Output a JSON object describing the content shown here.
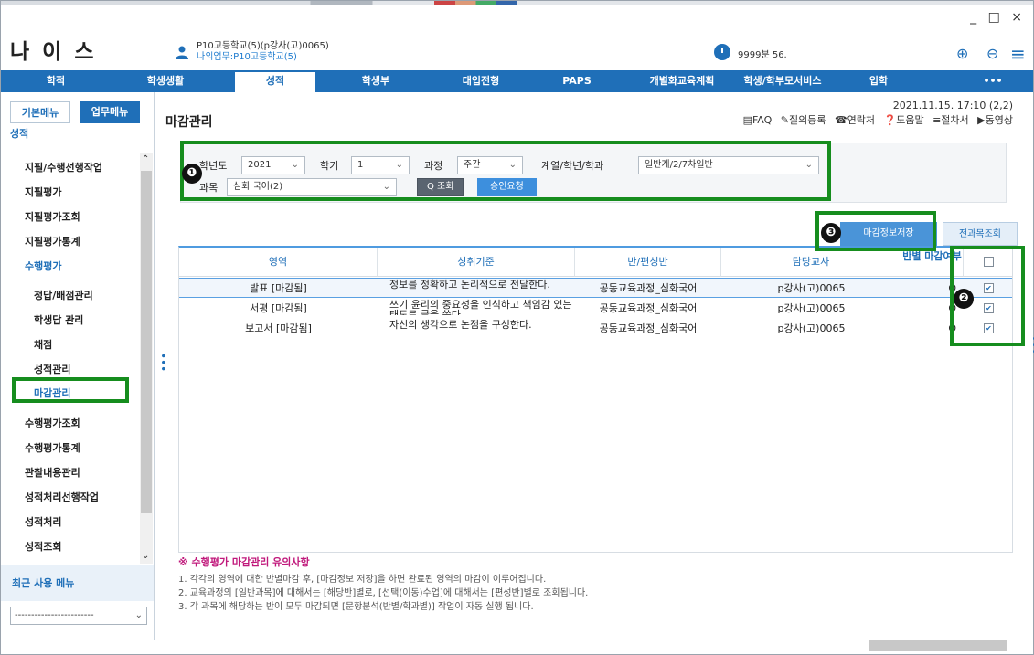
{
  "app": {
    "logo": "나 이 스",
    "window_controls": "_ □ ×",
    "user_line1": "P10고등학교(5)(p강사(고)0065)",
    "user_line2": "나의업무:P10고등학교(5)",
    "timer": "9999분 56.",
    "zoom_in": "⊕",
    "zoom_out": "⊖",
    "menu": "≡"
  },
  "nav": {
    "items": [
      "학적",
      "학생생활",
      "성적",
      "학생부",
      "대입전형",
      "PAPS",
      "개별화교육계획",
      "학생/학부모서비스",
      "입학",
      "•••"
    ]
  },
  "sidebar": {
    "tab_basic": "기본메뉴",
    "tab_work": "업무메뉴",
    "section": "성적",
    "items": [
      "지필/수행선행작업",
      "지필평가",
      "지필평가조회",
      "지필평가통계",
      "수행평가",
      "정답/배점관리",
      "학생답 관리",
      "채점",
      "성적관리",
      "마감관리",
      "수행평가조회",
      "수행평가통계",
      "관찰내용관리",
      "성적처리선행작업",
      "성적처리",
      "성적조회"
    ],
    "recent_label": "최근 사용 메뉴",
    "recent_value": "------------------------"
  },
  "main": {
    "title": "마감관리",
    "datetime": "2021.11.15. 17:10 (2,2)",
    "links": [
      "▤FAQ",
      "✎질의등록",
      "☎연락처",
      "❓도움말",
      "≡절차서",
      "▶동영상"
    ]
  },
  "filter": {
    "year_label": "학년도",
    "year_value": "2021",
    "term_label": "학기",
    "term_value": "1",
    "course_label": "과정",
    "course_value": "주간",
    "dept_label": "계열/학년/학과",
    "dept_value": "일반계/2/7차일반",
    "subject_label": "과목",
    "subject_value": "심화 국어(2)",
    "search_button": "Q 조회",
    "approve_button": "승인요청"
  },
  "actions": {
    "save_button": "마감정보저장",
    "all_subject_button": "전과목조회"
  },
  "grid": {
    "headers": [
      "영역",
      "성취기준",
      "반/편성반",
      "담당교사",
      "반별 마감여부"
    ],
    "rows": [
      {
        "area": "발표 [마감됨]",
        "standard": "정보를 정확하고 논리적으로 전달한다.",
        "class": "공동교육과정_심화국어",
        "teacher": "p강사(고)0065",
        "status": "O",
        "checked": true
      },
      {
        "area": "서평 [마감됨]",
        "standard": "쓰기 윤리의 중요성을 인식하고 책임감 있는 태도로 글을 쓴다.",
        "class": "공동교육과정_심화국어",
        "teacher": "p강사(고)0065",
        "status": "O",
        "checked": true
      },
      {
        "area": "보고서 [마감됨]",
        "standard": "자신의 생각으로 논점을 구성한다.",
        "class": "공동교육과정_심화국어",
        "teacher": "p강사(고)0065",
        "status": "O",
        "checked": true
      }
    ]
  },
  "notes": {
    "title": "※ 수행평가 마감관리 유의사항",
    "lines": [
      "1. 각각의 영역에 대한 반별마감 후, [마감정보 저장]을 하면 완료된 영역의 마감이 이루어집니다.",
      "2. 교육과정의 [일반과목]에 대해서는 [해당반]별로, [선택(이동)수업]에 대해서는 [편성반]별로 조회됩니다.",
      "3. 각 과목에 해당하는 반이 모두 마감되면 [문항분석(반별/학과별)] 작업이 자동 실행 됩니다."
    ]
  },
  "annotations": {
    "badge1": "❶",
    "badge2": "❷",
    "badge3": "❸",
    "highlight_color": "#168d1e"
  }
}
